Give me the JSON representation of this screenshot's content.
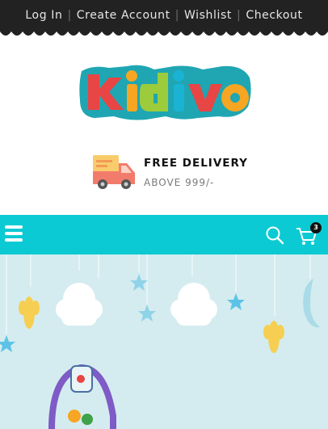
{
  "top_nav": {
    "items": [
      "Log In",
      "Create Account",
      "Wishlist",
      "Checkout"
    ],
    "separator": "|"
  },
  "logo": {
    "text": "kidivo"
  },
  "delivery": {
    "title": "FREE DELIVERY",
    "subtitle": "ABOVE 999/-"
  },
  "navbar": {
    "menu_icon": "hamburger-menu-icon",
    "search_icon": "search-icon",
    "cart_icon": "shopping-cart-icon",
    "cart_count": "3"
  },
  "colors": {
    "topbar_bg": "#222222",
    "navbar_bg": "#0ccad3",
    "banner_bg": "#d4ecef",
    "truck_body": "#f27c6b",
    "truck_cargo": "#f8cc6d"
  }
}
